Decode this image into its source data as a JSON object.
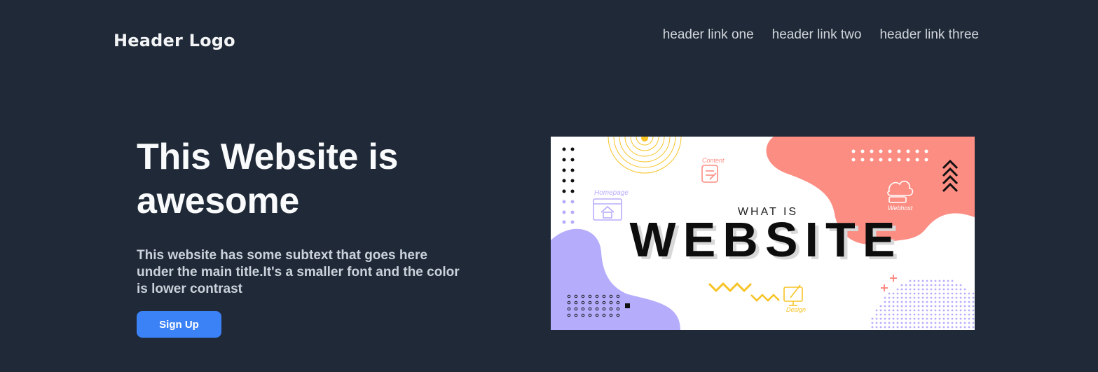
{
  "header": {
    "logo": "Header Logo",
    "links": [
      "header link one",
      "header link two",
      "header link three"
    ]
  },
  "hero": {
    "title": "This Website is awesome",
    "subtext": "This website has some subtext that goes here under the main title.It's a smaller font and the color is lower contrast",
    "cta_label": "Sign Up"
  },
  "image": {
    "line1": "WHAT IS",
    "line2": "WEBSITE",
    "labels": {
      "content": "Content",
      "homepage": "Homepage",
      "webhost": "Webhost",
      "design": "Design"
    }
  },
  "colors": {
    "background": "#1f2937",
    "button": "#3b82f6",
    "blob_coral": "#fc8d83",
    "blob_lavender": "#b5adfc",
    "accent_yellow": "#f7c325"
  }
}
